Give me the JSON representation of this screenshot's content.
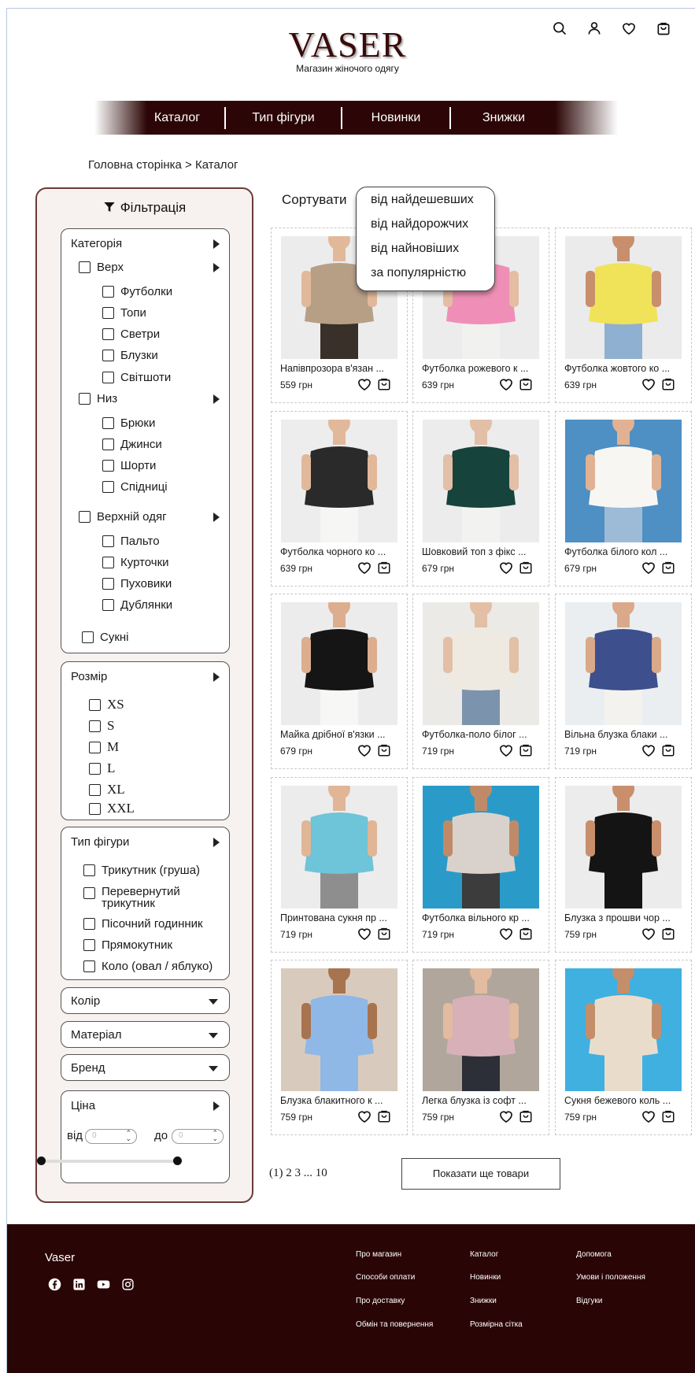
{
  "brand": {
    "logo": "VASER",
    "tagline": "Магазин жіночого одягу"
  },
  "header_icons": [
    "search-icon",
    "user-icon",
    "heart-icon",
    "bag-icon"
  ],
  "nav": [
    "Каталог",
    "Тип фігури",
    "Новинки",
    "Знижки"
  ],
  "breadcrumb": "Головна сторінка > Каталог",
  "filter": {
    "title": "Фільтрація",
    "category": {
      "label": "Категорія",
      "top": {
        "label": "Верх",
        "items": [
          "Футболки",
          "Топи",
          "Светри",
          "Блузки",
          "Світшоти"
        ]
      },
      "bottom": {
        "label": "Низ",
        "items": [
          "Брюки",
          "Джинси",
          "Шорти",
          "Спідниці"
        ]
      },
      "outer": {
        "label": "Верхній одяг",
        "items": [
          "Пальто",
          "Курточки",
          "Пуховики",
          "Дублянки"
        ]
      },
      "dresses": "Сукні"
    },
    "size": {
      "label": "Розмір",
      "items": [
        "XS",
        "S",
        "M",
        "L",
        "XL",
        "XXL"
      ]
    },
    "figure": {
      "label": "Тип фігури",
      "items": [
        "Трикутник (груша)",
        "Перевернутий трикутник",
        "Пісочний годинник",
        "Прямокутник",
        "Коло (овал / яблуко)"
      ]
    },
    "color": "Колір",
    "material": "Матеріал",
    "brand": "Бренд",
    "price": {
      "label": "Ціна",
      "from": "від",
      "to": "до",
      "from_value": "0",
      "to_value": "0"
    }
  },
  "sort": {
    "label": "Сортувати",
    "options": [
      "від найдешевших",
      "від найдорожчих",
      "від найновіших",
      "за популярністю"
    ]
  },
  "products": [
    {
      "name": "Напівпрозора в'язан ...",
      "price": "559 грн",
      "bg": "#ececec",
      "garment": "#b79f86",
      "skin": "#e2b89b",
      "legs": "#3a302a"
    },
    {
      "name": "Футболка рожевого к ...",
      "price": "639 грн",
      "bg": "#ececec",
      "garment": "#ef8fb7",
      "skin": "#e4bda3",
      "legs": "#f1f1ef"
    },
    {
      "name": "Футболка жовтого ко ...",
      "price": "639 грн",
      "bg": "#ebebeb",
      "garment": "#f0e35a",
      "skin": "#c98f6d",
      "legs": "#8fb0d0"
    },
    {
      "name": "Футболка чорного ко ...",
      "price": "639 грн",
      "bg": "#ededed",
      "garment": "#2a2a2a",
      "skin": "#e2b89b",
      "legs": "#f6f6f4"
    },
    {
      "name": "Шовковий топ з фікс ...",
      "price": "679 грн",
      "bg": "#ececec",
      "garment": "#17433d",
      "skin": "#e2bfa6",
      "legs": "#f2f2f0"
    },
    {
      "name": "Футболка білого кол ...",
      "price": "679 грн",
      "bg": "#4e8fc4",
      "garment": "#f8f6f2",
      "skin": "#e0b293",
      "legs": "#9dbbd6"
    },
    {
      "name": "Майка дрібної в'язки ...",
      "price": "679 грн",
      "bg": "#ececec",
      "garment": "#151515",
      "skin": "#dcae8e",
      "legs": "#f7f7f5"
    },
    {
      "name": "Футболка-поло білог ...",
      "price": "719 грн",
      "bg": "#eceae6",
      "garment": "#eeeae2",
      "skin": "#e3bfa5",
      "legs": "#7c93ad"
    },
    {
      "name": "Вільна блузка блаки ...",
      "price": "719 грн",
      "bg": "#eaeef0",
      "garment": "#3d4f8d",
      "skin": "#d9a98a",
      "legs": "#f4f2ee"
    },
    {
      "name": "Принтована сукня пр ...",
      "price": "719 грн",
      "bg": "#ececec",
      "garment": "#6ec4d8",
      "skin": "#e0b696",
      "legs": "#8e8e8e"
    },
    {
      "name": "Футболка вільного кр ...",
      "price": "719 грн",
      "bg": "#2a9bc9",
      "garment": "#d9d2cc",
      "skin": "#c08a68",
      "legs": "#3c3c3c"
    },
    {
      "name": "Блузка з прошви чор ...",
      "price": "759 грн",
      "bg": "#ececec",
      "garment": "#141414",
      "skin": "#c98f6d",
      "legs": "#141414"
    },
    {
      "name": "Блузка блакитного к ...",
      "price": "759 грн",
      "bg": "#d8cbbd",
      "garment": "#8fb8e6",
      "skin": "#a8734f",
      "legs": "#8fb8e6"
    },
    {
      "name": "Легка блузка із софт ...",
      "price": "759 грн",
      "bg": "#b0a69c",
      "garment": "#d7b1b7",
      "skin": "#e2bba0",
      "legs": "#2c2f38"
    },
    {
      "name": "Сукня бежевого коль ...",
      "price": "759 грн",
      "bg": "#3fb0e0",
      "garment": "#eadccb",
      "skin": "#c48e6a",
      "legs": "#eadccb"
    }
  ],
  "pagination": "(1) 2 3 ... 10",
  "show_more": "Показати ще товари",
  "footer": {
    "brand": "Vaser",
    "socials": [
      "facebook-icon",
      "linkedin-icon",
      "youtube-icon",
      "instagram-icon"
    ],
    "col1": [
      "Про магазин",
      "Способи оплати",
      "Про доставку",
      "Обмін та повернення"
    ],
    "col2": [
      "Каталог",
      "Новинки",
      "Знижки",
      "Розмірна сітка"
    ],
    "col3": [
      "Допомога",
      "Умови і положення",
      "Відгуки"
    ]
  },
  "colors": {
    "brand_dark": "#2a0505",
    "panel_bg": "#f7f1ef",
    "panel_border": "#6b3b3b"
  }
}
